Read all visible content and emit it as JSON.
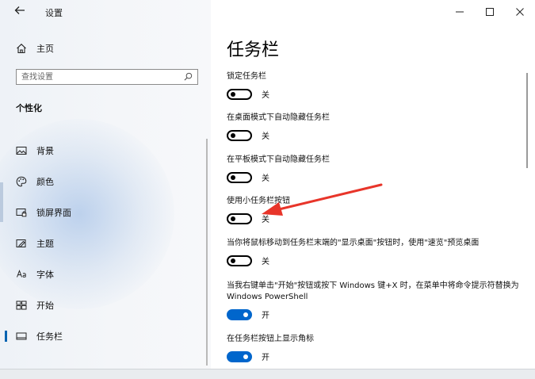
{
  "window": {
    "title": "设置",
    "controls": {
      "minimize": "—",
      "maximize": "☐",
      "close": "✕"
    }
  },
  "sidebar": {
    "home_label": "主页",
    "search_placeholder": "查找设置",
    "section_title": "个性化",
    "items": [
      {
        "label": "背景",
        "icon": "image-icon"
      },
      {
        "label": "颜色",
        "icon": "palette-icon"
      },
      {
        "label": "锁屏界面",
        "icon": "lock-screen-icon"
      },
      {
        "label": "主题",
        "icon": "theme-icon"
      },
      {
        "label": "字体",
        "icon": "font-icon"
      },
      {
        "label": "开始",
        "icon": "start-icon"
      },
      {
        "label": "任务栏",
        "icon": "taskbar-icon",
        "active": true
      }
    ]
  },
  "main": {
    "page_title": "任务栏",
    "settings": [
      {
        "title": "锁定任务栏",
        "on": false,
        "state": "关"
      },
      {
        "title": "在桌面模式下自动隐藏任务栏",
        "on": false,
        "state": "关"
      },
      {
        "title": "在平板模式下自动隐藏任务栏",
        "on": false,
        "state": "关"
      },
      {
        "title": "使用小任务栏按钮",
        "on": false,
        "state": "关"
      },
      {
        "title": "当你将鼠标移动到任务栏末端的\"显示桌面\"按钮时，使用\"速览\"预览桌面",
        "on": false,
        "state": "关"
      },
      {
        "title": "当我右键单击\"开始\"按钮或按下 Windows 键+X 时，在菜单中将命令提示符替换为 Windows PowerShell",
        "on": true,
        "state": "开"
      },
      {
        "title": "在任务栏按钮上显示角标",
        "on": true,
        "state": "开"
      }
    ]
  },
  "colors": {
    "accent": "#0066cc",
    "annotation_arrow": "#e8352a"
  }
}
